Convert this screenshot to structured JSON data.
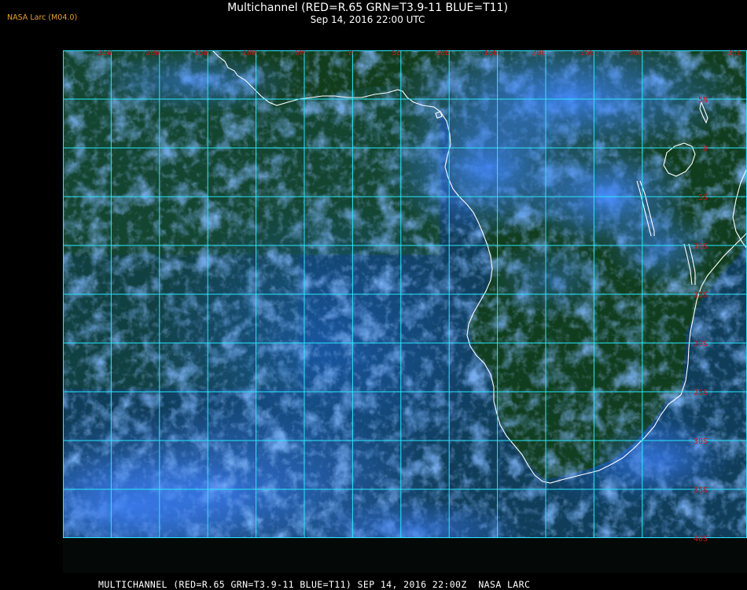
{
  "header": {
    "credit": "NASA Larc (M04.0)",
    "title": "Multichannel (RED=R.65 GRN=T3.9-11 BLUE=T11)",
    "subtitle": "Sep 14, 2016 22:00 UTC"
  },
  "footer": {
    "caption": "MULTICHANNEL (RED=R.65 GRN=T3.9-11 BLUE=T11) SEP 14, 2016 22:00Z  NASA LARC"
  },
  "map": {
    "longitude_labels": [
      "25W",
      "20W",
      "15W",
      "10W",
      "5W",
      "0",
      "5E",
      "10E",
      "15E",
      "20E",
      "25E",
      "30E",
      "35E"
    ],
    "latitude_labels": [
      "5N",
      "0",
      "5S",
      "10S",
      "15S",
      "20S",
      "25S",
      "30S",
      "35S",
      "40S"
    ],
    "colors": {
      "grid": "#29e6ff",
      "coast": "#ffffff",
      "label": "#c41818",
      "ocean": "#0f3d5a",
      "land": "#123d1c",
      "cloud": "#3a7cff"
    }
  }
}
